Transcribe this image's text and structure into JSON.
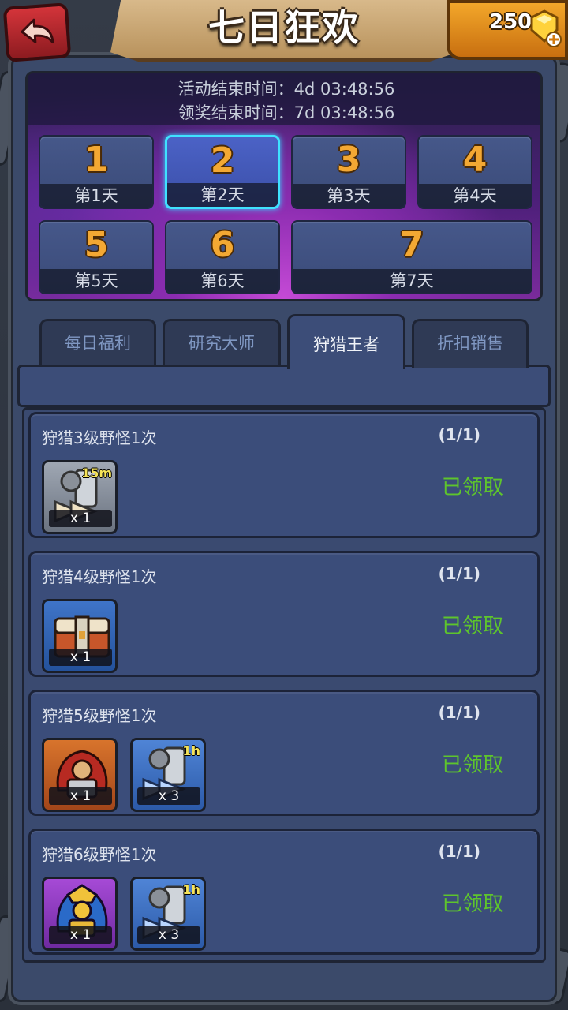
{
  "header": {
    "title": "七日狂欢",
    "gems": "250"
  },
  "countdown": {
    "activity_end": "活动结束时间：4d 03:48:56",
    "claim_end": "领奖结束时间：7d 03:48:56"
  },
  "days": [
    {
      "num": "1",
      "label": "第1天"
    },
    {
      "num": "2",
      "label": "第2天"
    },
    {
      "num": "3",
      "label": "第3天"
    },
    {
      "num": "4",
      "label": "第4天"
    },
    {
      "num": "5",
      "label": "第5天"
    },
    {
      "num": "6",
      "label": "第6天"
    },
    {
      "num": "7",
      "label": "第7天"
    }
  ],
  "selected_day": "2",
  "tabs": [
    {
      "label": "每日福利"
    },
    {
      "label": "研究大师"
    },
    {
      "label": "狩猎王者"
    },
    {
      "label": "折扣销售"
    }
  ],
  "active_tab": "狩猎王者",
  "tasks": [
    {
      "name": "狩猎3级野怪1次",
      "progress": "(1/1)",
      "status": "已领取",
      "rewards": [
        {
          "icon": "speedup-hammer-icon",
          "qty": "x 1",
          "timer": "15m"
        }
      ]
    },
    {
      "name": "狩猎4级野怪1次",
      "progress": "(1/1)",
      "status": "已领取",
      "rewards": [
        {
          "icon": "treasure-chest-icon",
          "qty": "x 1"
        }
      ]
    },
    {
      "name": "狩猎5级野怪1次",
      "progress": "(1/1)",
      "status": "已领取",
      "rewards": [
        {
          "icon": "red-hero-card-icon",
          "qty": "x 1"
        },
        {
          "icon": "speedup-hammer-icon",
          "qty": "x 3",
          "timer": "1h"
        }
      ]
    },
    {
      "name": "狩猎6级野怪1次",
      "progress": "(1/1)",
      "status": "已领取",
      "rewards": [
        {
          "icon": "purple-hero-card-icon",
          "qty": "x 1"
        },
        {
          "icon": "speedup-hammer-icon",
          "qty": "x 3",
          "timer": "1h"
        }
      ]
    }
  ],
  "colors": {
    "claimed_green": "#5ec52c",
    "active_tile_border": "#3fe2ff",
    "day_number_orange": "#f3a833"
  }
}
